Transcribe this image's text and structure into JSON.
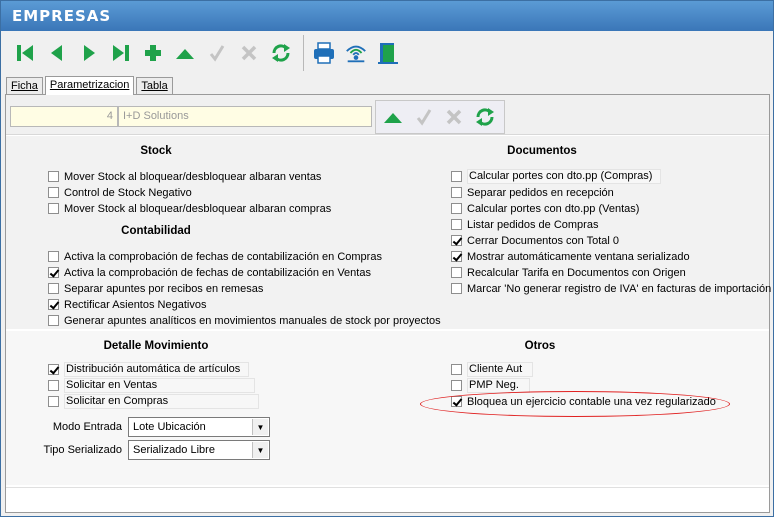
{
  "window": {
    "title": "EMPRESAS"
  },
  "tabs": [
    {
      "label": "Ficha"
    },
    {
      "label": "Parametrizacion"
    },
    {
      "label": "Tabla"
    }
  ],
  "header": {
    "code_value": "4",
    "name_value": "I+D Solutions"
  },
  "stock": {
    "title": "Stock",
    "items": [
      {
        "label": "Mover Stock al bloquear/desbloquear albaran ventas",
        "checked": false
      },
      {
        "label": "Control de Stock Negativo",
        "checked": false
      },
      {
        "label": "Mover Stock al bloquear/desbloquear albaran compras",
        "checked": false
      }
    ]
  },
  "contabilidad": {
    "title": "Contabilidad",
    "items": [
      {
        "label": "Activa la comprobación de fechas de contabilización en Compras",
        "checked": false
      },
      {
        "label": "Activa la comprobación de fechas de contabilización en Ventas",
        "checked": true
      },
      {
        "label": "Separar apuntes por recibos en remesas",
        "checked": false
      },
      {
        "label": "Rectificar Asientos Negativos",
        "checked": true
      },
      {
        "label": "Generar apuntes analíticos en movimientos manuales de stock por proyectos",
        "checked": false
      }
    ]
  },
  "documentos": {
    "title": "Documentos",
    "items": [
      {
        "label": "Calcular portes con dto.pp (Compras)",
        "checked": false
      },
      {
        "label": "Separar pedidos en recepción",
        "checked": false
      },
      {
        "label": "Calcular portes con dto.pp (Ventas)",
        "checked": false
      },
      {
        "label": "Listar pedidos de Compras",
        "checked": false
      },
      {
        "label": "Cerrar Documentos con Total 0",
        "checked": true
      },
      {
        "label": "Mostrar automáticamente ventana serializado",
        "checked": true
      },
      {
        "label": "Recalcular Tarifa en Documentos con Origen",
        "checked": false
      },
      {
        "label": "Marcar 'No generar registro de IVA' en facturas de importación",
        "checked": false
      }
    ]
  },
  "detalle": {
    "title": "Detalle Movimiento",
    "items": [
      {
        "label": "Distribución automática de artículos",
        "checked": true
      },
      {
        "label": "Solicitar en Ventas",
        "checked": false
      },
      {
        "label": "Solicitar en Compras",
        "checked": false
      }
    ],
    "modo_entrada_label": "Modo Entrada",
    "modo_entrada_value": "Lote Ubicación",
    "tipo_serializado_label": "Tipo Serializado",
    "tipo_serializado_value": "Serializado Libre"
  },
  "otros": {
    "title": "Otros",
    "items": [
      {
        "label": "Cliente Aut",
        "checked": false
      },
      {
        "label": "PMP Neg.",
        "checked": false
      },
      {
        "label": "Bloquea un ejercicio contable una vez regularizado",
        "checked": true
      }
    ]
  },
  "colors": {
    "title_bar": "#3a76b8",
    "icon_green": "#1fa24a",
    "icon_blue": "#1f6fb8",
    "annotation_red": "#e02020"
  }
}
